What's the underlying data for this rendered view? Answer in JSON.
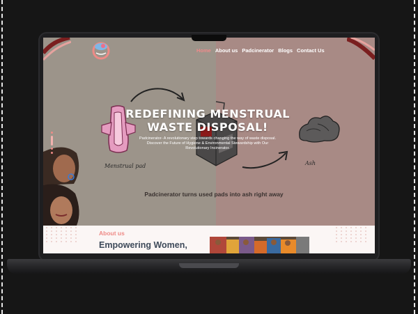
{
  "nav": {
    "items": [
      {
        "label": "Home",
        "active": true
      },
      {
        "label": "About us",
        "active": false
      },
      {
        "label": "Padcinerator",
        "active": false
      },
      {
        "label": "Blogs",
        "active": false
      },
      {
        "label": "Contact Us",
        "active": false
      }
    ]
  },
  "hero": {
    "title_line1": "REDEFINING MENSTRUAL",
    "title_line2": "WASTE DISPOSAL!",
    "desc_line1": "Padcinerator- A revolutionary step towards changing the way of waste disposal.",
    "desc_line2": "Discover the Future of Hygiene & Environmental Stewardship with Our",
    "desc_line3": "Revolutionary Incinerator.",
    "label_pad": "Menstrual pad",
    "label_ash": "Ash",
    "tagline": "Padcinerator turns used pads into ash right away"
  },
  "about": {
    "section_label": "About us",
    "heading": "Empowering Women,"
  },
  "colors": {
    "accent": "#ee8a86",
    "hero_left": "#9c948a",
    "hero_right": "#a88a85",
    "heading": "#3e4a5a"
  }
}
